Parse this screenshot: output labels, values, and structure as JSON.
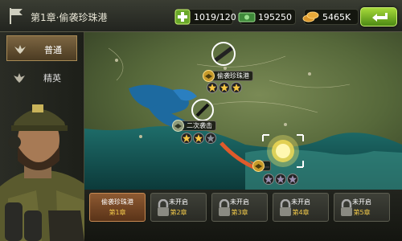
{
  "topbar": {
    "chapter_title": "第1章·偷袭珍珠港",
    "energy": "1019/120",
    "cash": "195250",
    "gold": "5465K"
  },
  "sidebar": {
    "tabs": [
      {
        "label": "普通",
        "icon": "eagle-icon",
        "selected": true
      },
      {
        "label": "精英",
        "icon": "eagle-emblem-icon",
        "selected": false
      }
    ]
  },
  "map": {
    "battles": [
      {
        "label": "偷袭珍珠港",
        "stars_earned": 3,
        "stars_total": 3
      },
      {
        "label": "二次袭击",
        "stars_earned": 2,
        "stars_total": 3
      },
      {
        "label": "",
        "stars_earned": 0,
        "stars_total": 3
      }
    ]
  },
  "chapters": [
    {
      "line1": "偷袭珍珠港",
      "line2": "第1章",
      "locked": false
    },
    {
      "line1": "未开启",
      "line2": "第2章",
      "locked": true
    },
    {
      "line1": "未开启",
      "line2": "第3章",
      "locked": true
    },
    {
      "line1": "未开启",
      "line2": "第4章",
      "locked": true
    },
    {
      "line1": "未开启",
      "line2": "第5章",
      "locked": true
    }
  ],
  "colors": {
    "accent_green": "#8cc63f",
    "star_gold": "#f5c542",
    "chapter_label": "#f0c84a",
    "route_arrow": "#e05a2b"
  }
}
